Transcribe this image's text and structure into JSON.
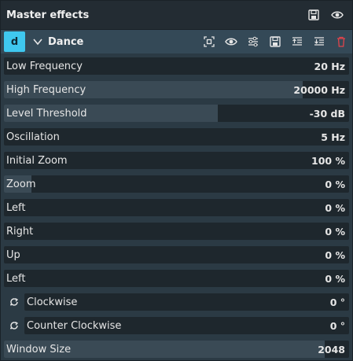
{
  "header": {
    "title": "Master effects",
    "icons": [
      "save-icon",
      "eye-icon"
    ]
  },
  "effect": {
    "badge": "d",
    "name": "Dance",
    "icons": [
      "keyframe-icon",
      "eye-icon",
      "adjust-icon",
      "save-icon",
      "move-up-icon",
      "move-down-icon",
      "delete-icon"
    ],
    "accent": "#3fc8f0",
    "delete_color": "#e0444b"
  },
  "params": [
    {
      "label": "Low Frequency",
      "value": "20 Hz",
      "fill": 0.0
    },
    {
      "label": "High Frequency",
      "value": "20000 Hz",
      "fill": 0.865
    },
    {
      "label": "Level Threshold",
      "value": "-30 dB",
      "fill": 0.62
    },
    {
      "label": "Oscillation",
      "value": "5 Hz",
      "fill": 0.0
    },
    {
      "label": "Initial Zoom",
      "value": "100 %",
      "fill": 0.0
    },
    {
      "label": "Zoom",
      "value": "0 %",
      "fill": 0.08
    },
    {
      "label": "Left",
      "value": "0 %",
      "fill": 0.0
    },
    {
      "label": "Right",
      "value": "0 %",
      "fill": 0.0
    },
    {
      "label": "Up",
      "value": "0 %",
      "fill": 0.0
    },
    {
      "label": "Left",
      "value": "0 %",
      "fill": 0.0
    },
    {
      "label": "Clockwise",
      "value": "0 °",
      "fill": 0.0,
      "icon": "rotate-icon"
    },
    {
      "label": "Counter Clockwise",
      "value": "0 °",
      "fill": 0.0,
      "icon": "rotate-icon"
    },
    {
      "label": "Window Size",
      "value": "2048",
      "fill": 0.93
    }
  ]
}
